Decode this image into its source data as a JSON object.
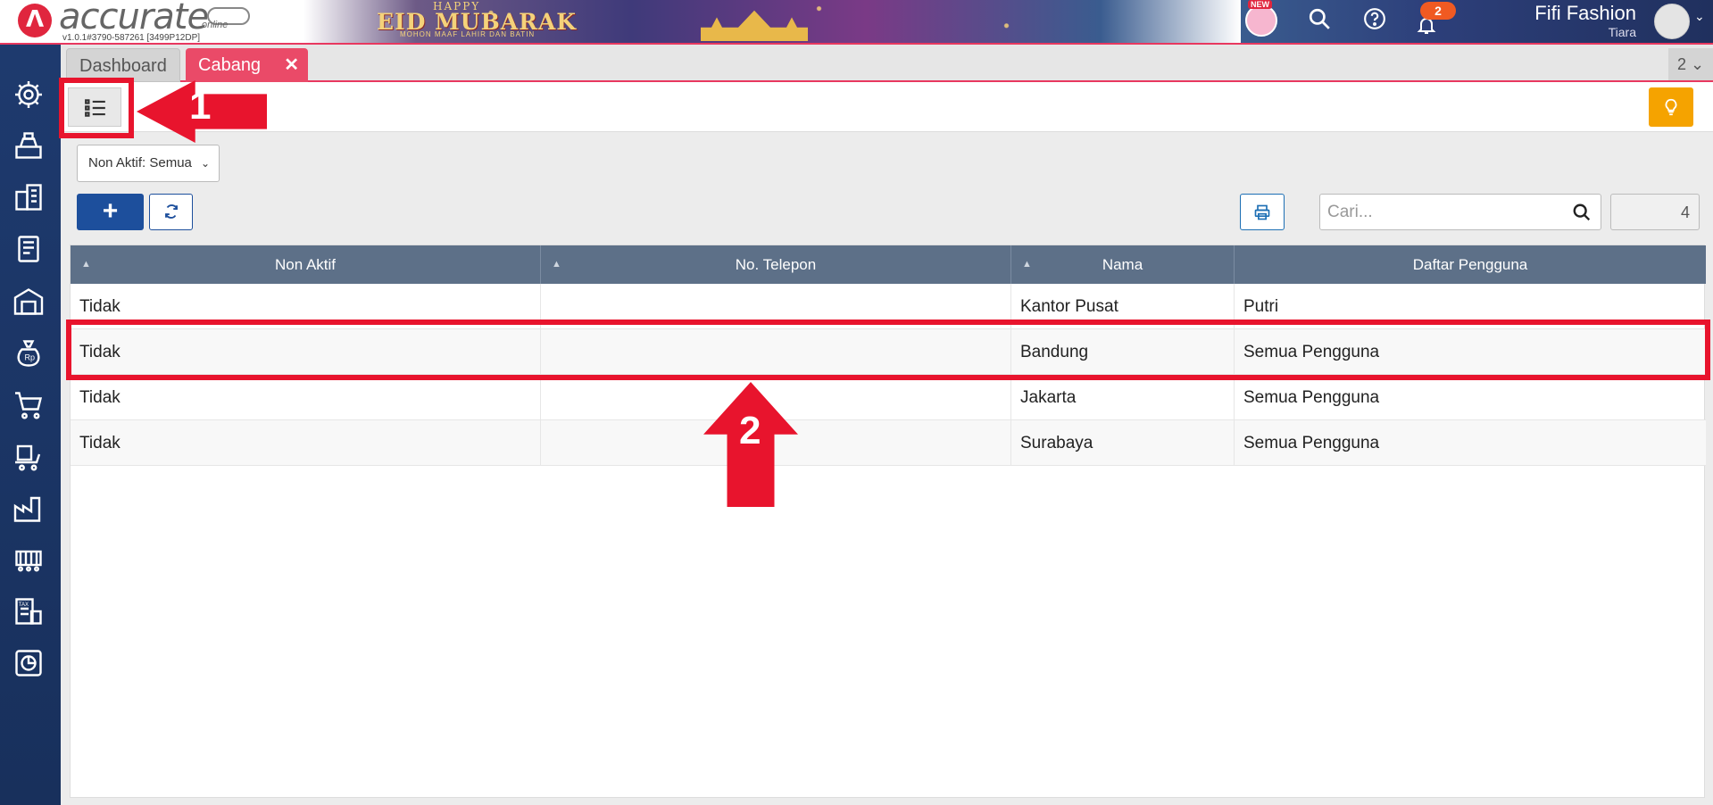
{
  "header": {
    "logo_text": "accurate",
    "logo_sub": "online",
    "version": "v1.0.1#3790-587261 [3499P12DP]",
    "banner": {
      "happy": "HAPPY",
      "title": "EID MUBARAK",
      "subtitle": "MOHON MAAF LAHIR DAN BATIN"
    },
    "new_badge": "NEW",
    "notif_count": "2",
    "company": "Fifi Fashion",
    "user": "Tiara"
  },
  "tabs": [
    {
      "label": "Dashboard"
    },
    {
      "label": "Cabang"
    }
  ],
  "tab_count": "2",
  "filter": {
    "label": "Non Aktif: Semua"
  },
  "search": {
    "placeholder": "Cari...",
    "value": ""
  },
  "record_count": "4",
  "table": {
    "columns": [
      "Non Aktif",
      "No. Telepon",
      "Nama",
      "Daftar Pengguna"
    ],
    "rows": [
      {
        "non_aktif": "Tidak",
        "telepon": "",
        "nama": "Kantor Pusat",
        "pengguna": "Putri"
      },
      {
        "non_aktif": "Tidak",
        "telepon": "",
        "nama": "Bandung",
        "pengguna": "Semua Pengguna"
      },
      {
        "non_aktif": "Tidak",
        "telepon": "",
        "nama": "Jakarta",
        "pengguna": "Semua Pengguna"
      },
      {
        "non_aktif": "Tidak",
        "telepon": "",
        "nama": "Surabaya",
        "pengguna": "Semua Pengguna"
      }
    ]
  },
  "annotations": [
    "1",
    "2"
  ],
  "colors": {
    "accent": "#e8385f",
    "primary": "#1d4f9c",
    "annotation": "#e8142d",
    "header_table": "#5d7088"
  },
  "sidebar_icons": [
    "settings-icon",
    "cash-register-icon",
    "building-icon",
    "ledger-icon",
    "warehouse-icon",
    "money-bag-icon",
    "cart-icon",
    "purchase-icon",
    "factory-icon",
    "production-icon",
    "tax-icon",
    "report-icon"
  ]
}
